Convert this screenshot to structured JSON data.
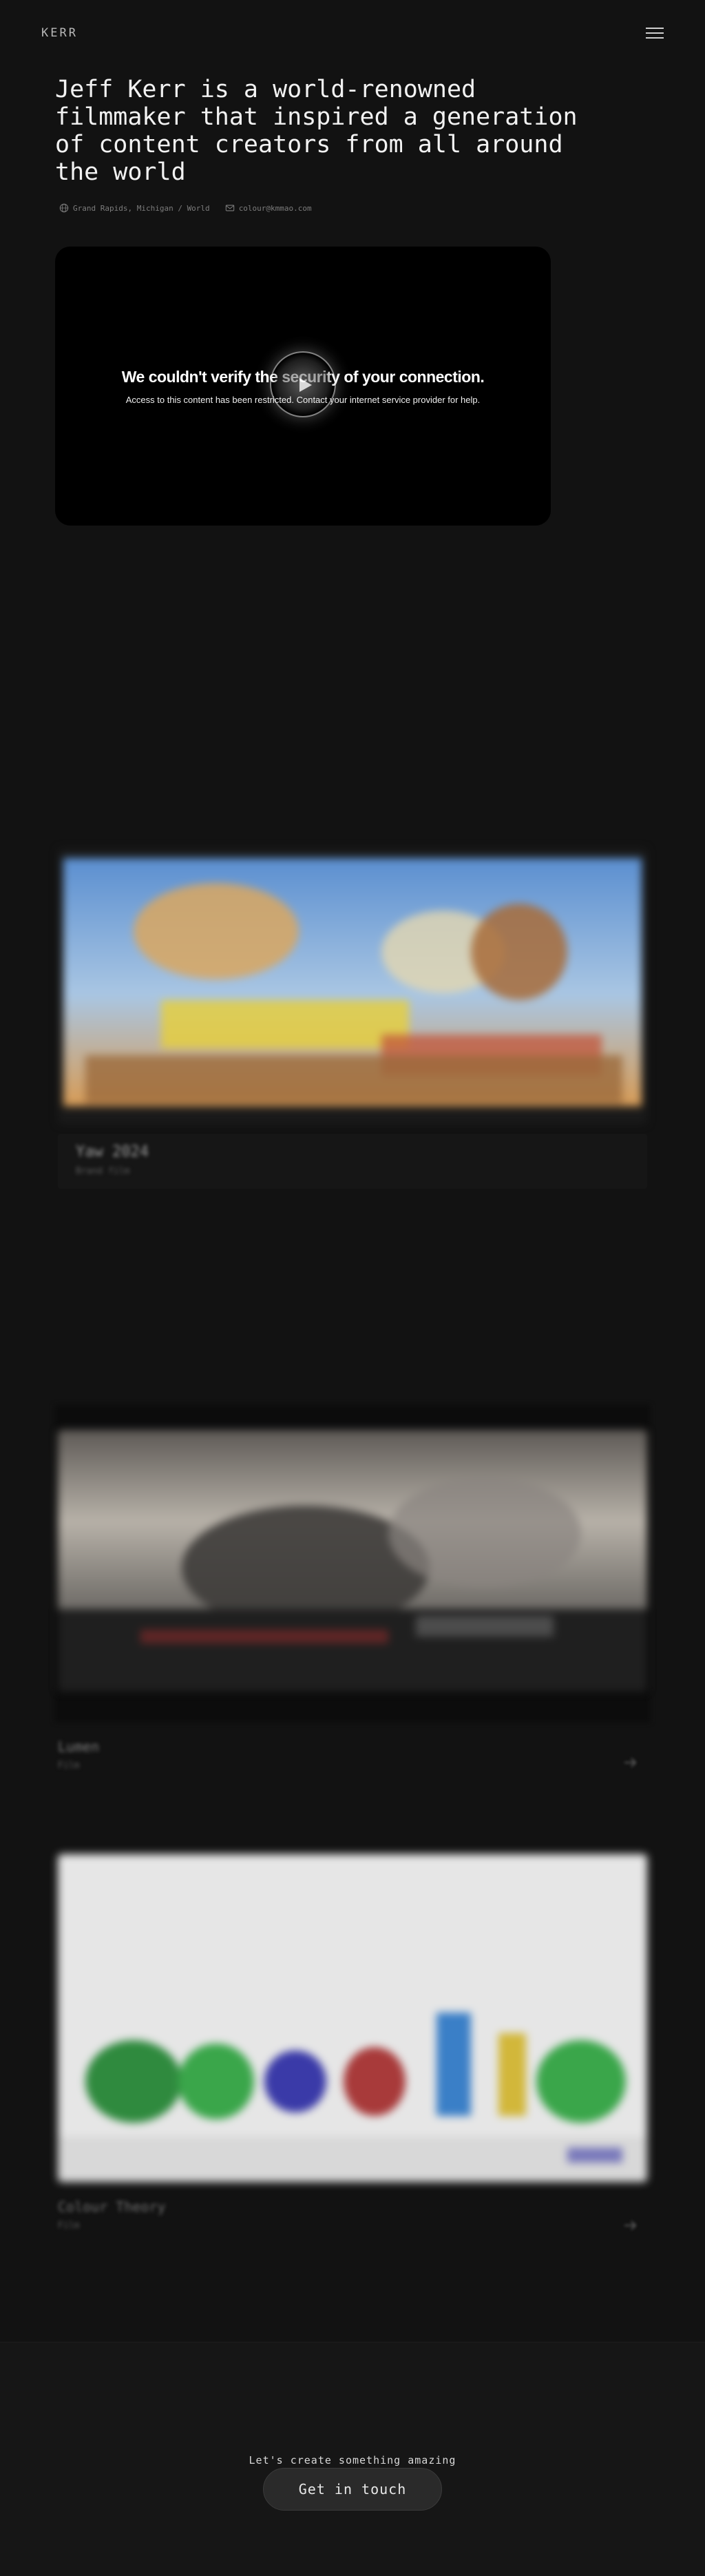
{
  "header": {
    "logo": "KERR",
    "menu_icon": "hamburger-menu-icon"
  },
  "hero": {
    "title": "Jeff Kerr is a world-renowned filmmaker that inspired a generation of content creators from all around the world",
    "location": "Grand Rapids, Michigan / World",
    "email": "colour@kmmao.com",
    "location_icon": "globe-icon",
    "email_icon": "mail-icon"
  },
  "video": {
    "error_title": "We couldn't verify the security of your connection.",
    "error_subtitle": "Access to this content has been restricted. Contact your internet service provider for help.",
    "play_icon": "play-icon"
  },
  "projects": [
    {
      "title": "Yaw 2024",
      "subtitle": "Brand film"
    },
    {
      "title": "Lumen",
      "subtitle": "Film"
    },
    {
      "title": "Colour Theory",
      "subtitle": "Film"
    }
  ],
  "footer": {
    "tagline": "Let's create something amazing",
    "cta_label": "Get in touch"
  },
  "colors": {
    "background": "#121212",
    "text": "#f2f2f2",
    "muted": "#7c7c7c"
  }
}
